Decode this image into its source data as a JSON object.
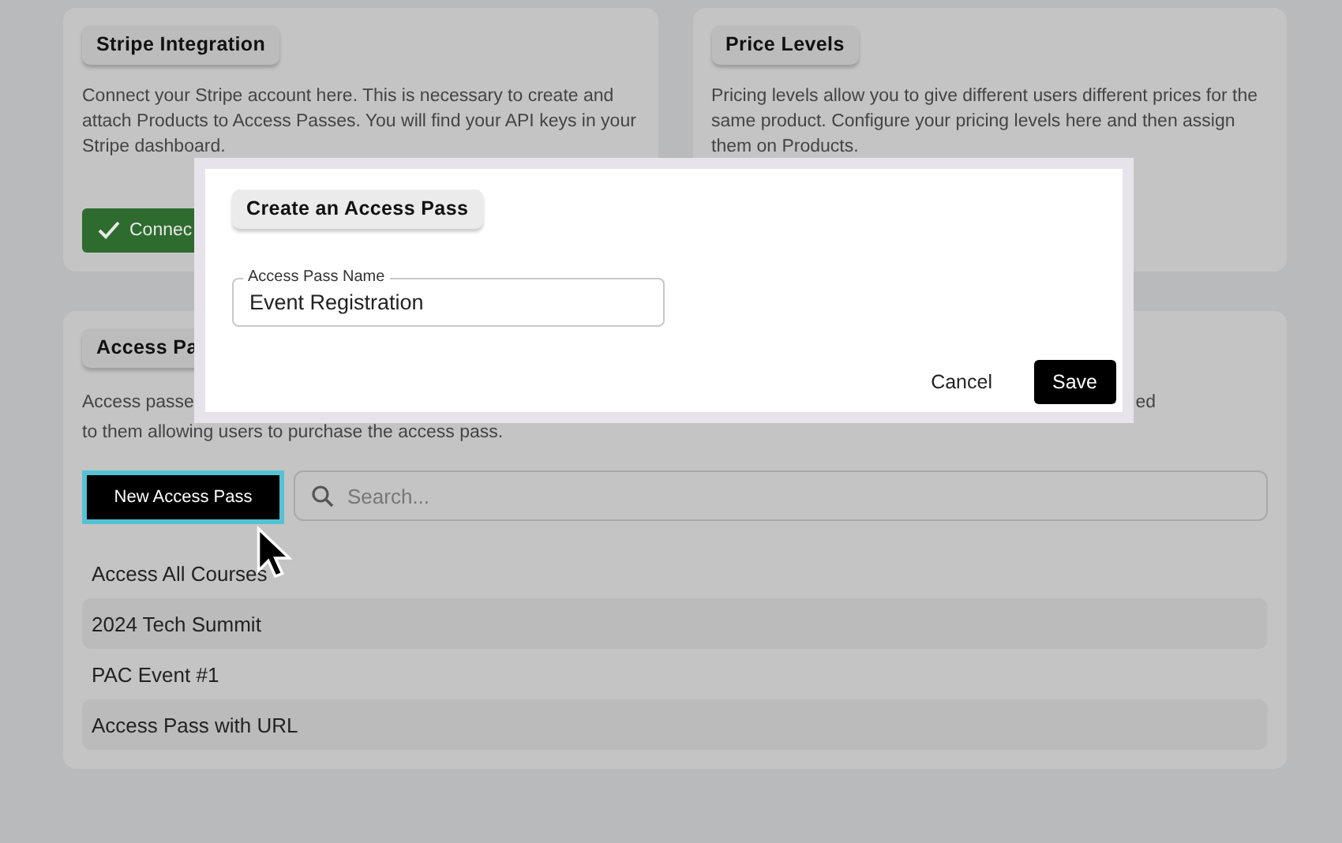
{
  "cards": [
    {
      "title": "Stripe Integration",
      "text": "Connect your Stripe account here. This is necessary to create and attach Products to Access Passes. You will find your API keys in your Stripe dashboard.",
      "button": "Connec"
    },
    {
      "title": "Price Levels",
      "text": "Pricing levels allow you to give different users different prices for the same product. Configure your pricing levels here and then assign them on Products."
    }
  ],
  "access_passes": {
    "title": "Access Pa",
    "text_left": "Access passe",
    "text_right": "ed",
    "text_line_2": "to them allowing users to purchase the access pass.",
    "new_button": "New Access Pass",
    "new_button_focused": true,
    "search": {
      "placeholder": "Search..."
    },
    "items": [
      "Access All Courses",
      "2024 Tech Summit",
      "PAC Event #1",
      "Access Pass with URL"
    ]
  },
  "dialog": {
    "title": "Create an Access Pass",
    "field": {
      "label": "Access Pass Name",
      "value": "Event Registration"
    },
    "buttons": [
      {
        "label": "Cancel",
        "kind": "text"
      },
      {
        "label": "Save",
        "kind": "primary"
      }
    ]
  }
}
